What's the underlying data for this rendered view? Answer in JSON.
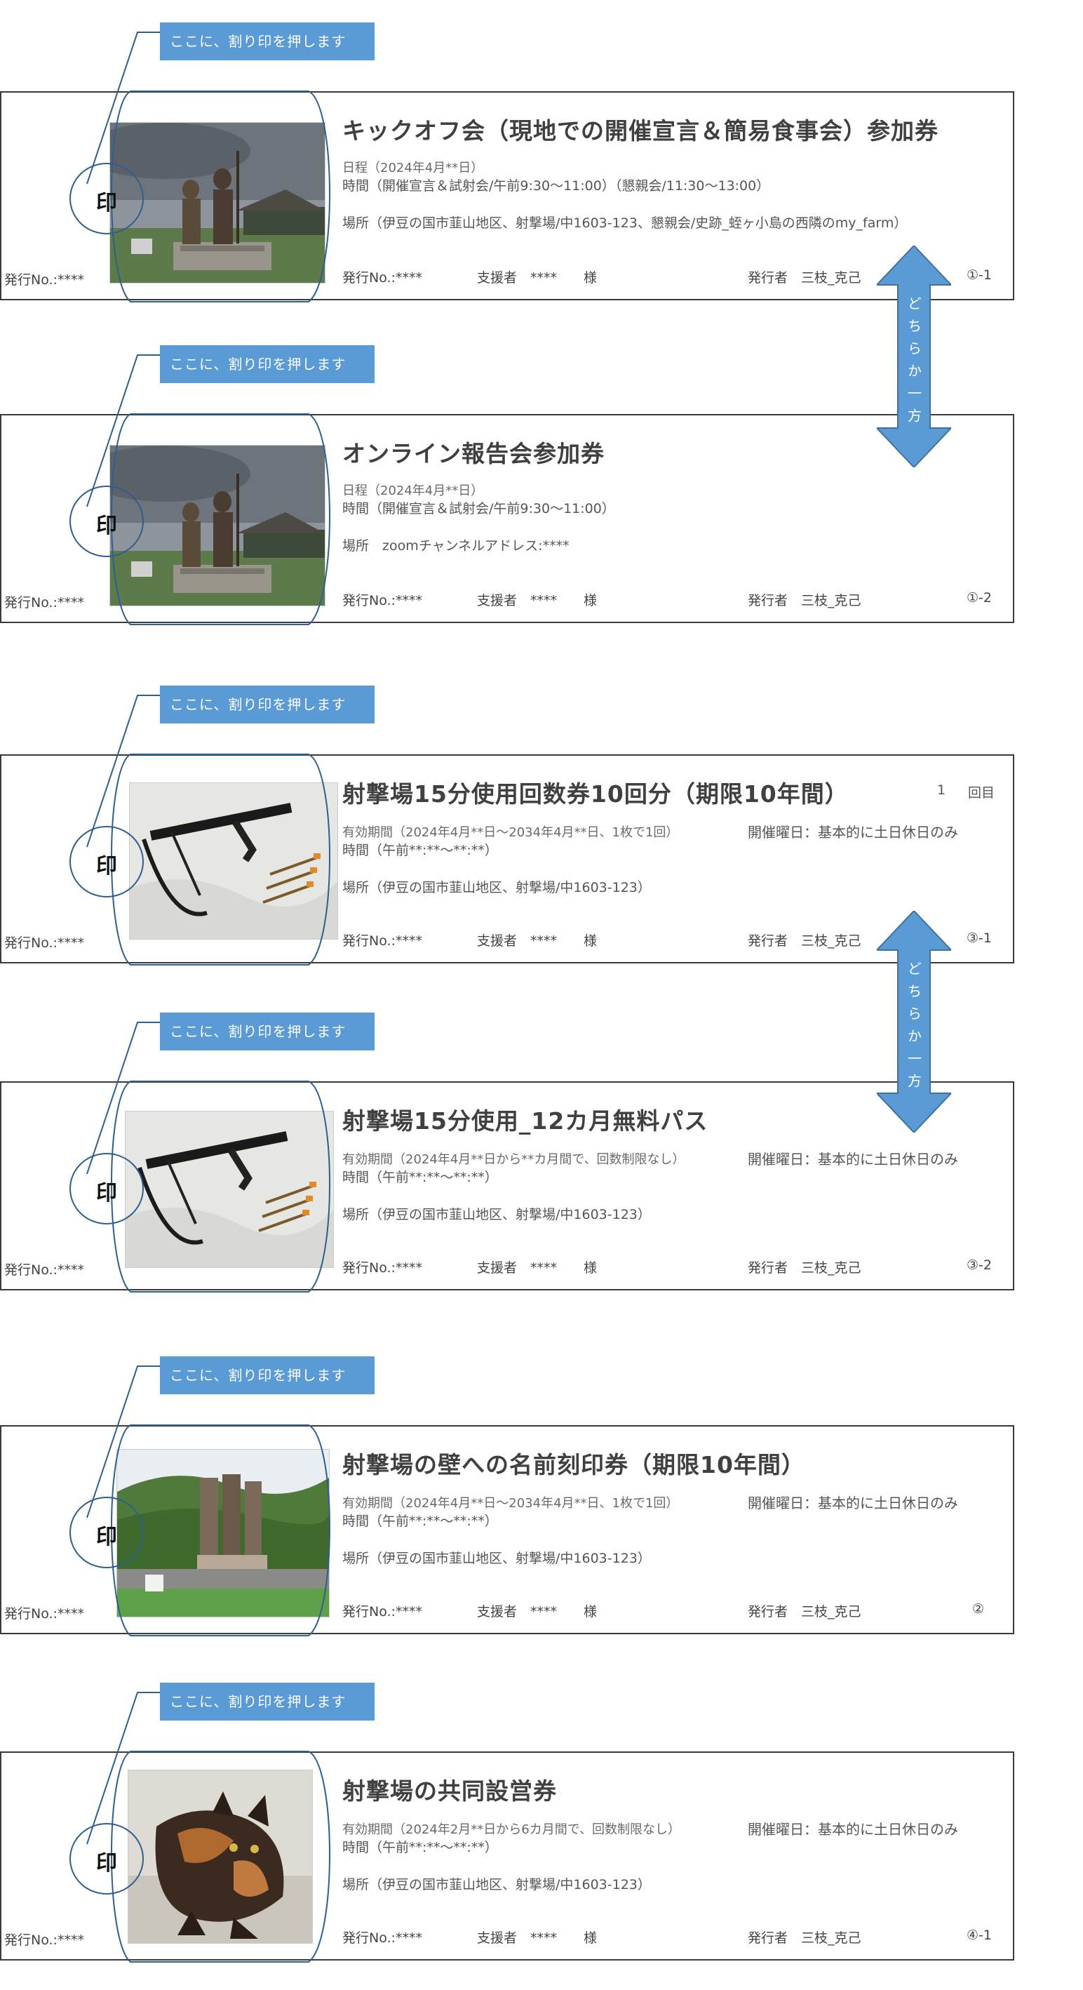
{
  "common": {
    "stamp_label": "ここに、割り印を押します",
    "seal": "印",
    "issue_no": "発行No.:****",
    "supporter": "支援者　****　　様",
    "issuer": "発行者　三枝_克己"
  },
  "arrows": [
    {
      "text": "どちらか一方"
    },
    {
      "text": "どちらか一方"
    }
  ],
  "tickets": [
    {
      "title": "キックオフ会（現地での開催宣言＆簡易食事会）参加券",
      "line1": "日程（2024年4月**日）",
      "line2": "時間（開催宣言＆試射会/午前9:30〜11:00）（懇親会/11:30〜13:00）",
      "line3": "場所（伊豆の国市韮山地区、射撃場/中1603-123、懇親会/史跡_蛭ヶ小島の西隣のmy_farm）",
      "code": "①-1",
      "photo": "statue"
    },
    {
      "title": "オンライン報告会参加券",
      "line1": "日程（2024年4月**日）",
      "line2": "時間（開催宣言＆試射会/午前9:30〜11:00）",
      "line3": "場所　zoomチャンネルアドレス:****",
      "code": "①-2",
      "photo": "statue"
    },
    {
      "title": "射撃場15分使用回数券10回分（期限10年間）",
      "count_num": "1",
      "count_unit": "回目",
      "line1": "有効期間（2024年4月**日〜2034年4月**日、1枚で1回）",
      "days": "開催曜日：基本的に土日休日のみ",
      "line2": "時間（午前**:**〜**:**）",
      "line3": "場所（伊豆の国市韮山地区、射撃場/中1603-123）",
      "code": "③-1",
      "photo": "crossbow"
    },
    {
      "title": "射撃場15分使用_12カ月無料パス",
      "line1": "有効期間（2024年4月**日から**カ月間で、回数制限なし）",
      "days": "開催曜日：基本的に土日休日のみ",
      "line2": "時間（午前**:**〜**:**）",
      "line3": "場所（伊豆の国市韮山地区、射撃場/中1603-123）",
      "code": "③-2",
      "photo": "crossbow"
    },
    {
      "title": "射撃場の壁への名前刻印券（期限10年間）",
      "line1": "有効期間（2024年4月**日〜2034年4月**日、1枚で1回）",
      "days": "開催曜日：基本的に土日休日のみ",
      "line2": "時間（午前**:**〜**:**）",
      "line3": "場所（伊豆の国市韮山地区、射撃場/中1603-123）",
      "code": "②",
      "photo": "furnace"
    },
    {
      "title": "射撃場の共同設営券",
      "line1": "有効期間（2024年2月**日から6カ月間で、回数制限なし）",
      "days": "開催曜日：基本的に土日休日のみ",
      "line2": "時間（午前**:**〜**:**）",
      "line3": "場所（伊豆の国市韮山地区、射撃場/中1603-123）",
      "code": "④-1",
      "photo": "cat"
    }
  ]
}
